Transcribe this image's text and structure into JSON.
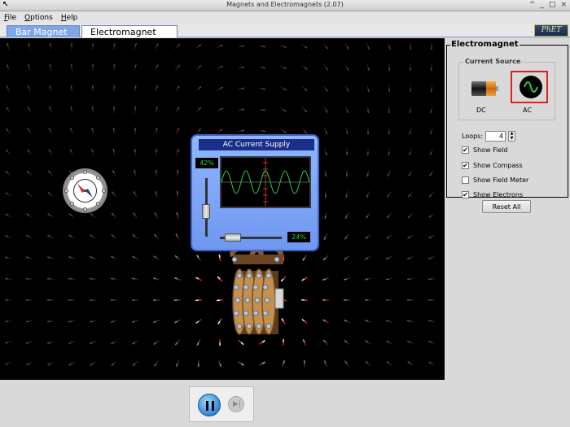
{
  "window": {
    "title": "Magnets and Electromagnets (2.07)",
    "controls": [
      "^",
      "_",
      "□",
      "×"
    ]
  },
  "menu": [
    {
      "label": "File",
      "mnemonic": "F",
      "rest": "ile"
    },
    {
      "label": "Options",
      "mnemonic": "O",
      "rest": "ptions"
    },
    {
      "label": "Help",
      "mnemonic": "H",
      "rest": "elp"
    }
  ],
  "tabs": {
    "bar_magnet": "Bar Magnet",
    "electromagnet": "Electromagnet",
    "active": "Electromagnet"
  },
  "logo": "PhET",
  "supply": {
    "title": "AC Current Supply",
    "vertical_percent": "42%",
    "horizontal_percent": "24%"
  },
  "panel": {
    "title": "Electromagnet",
    "current_source": {
      "legend": "Current Source",
      "dc_label": "DC",
      "ac_label": "AC",
      "selected": "AC"
    },
    "loops_label": "Loops:",
    "loops_value": "4",
    "checkboxes": [
      {
        "label": "Show Field",
        "checked": true
      },
      {
        "label": "Show Compass",
        "checked": true
      },
      {
        "label": "Show Field Meter",
        "checked": false
      },
      {
        "label": "Show Electrons",
        "checked": true
      }
    ],
    "reset_label": "Reset All"
  },
  "colors": {
    "tab_inactive": "#7fa6e8",
    "selection_border": "#e02020",
    "scope_trace": "#2ecc40"
  },
  "icons": {
    "pause": "pause-icon",
    "step": "step-icon"
  }
}
